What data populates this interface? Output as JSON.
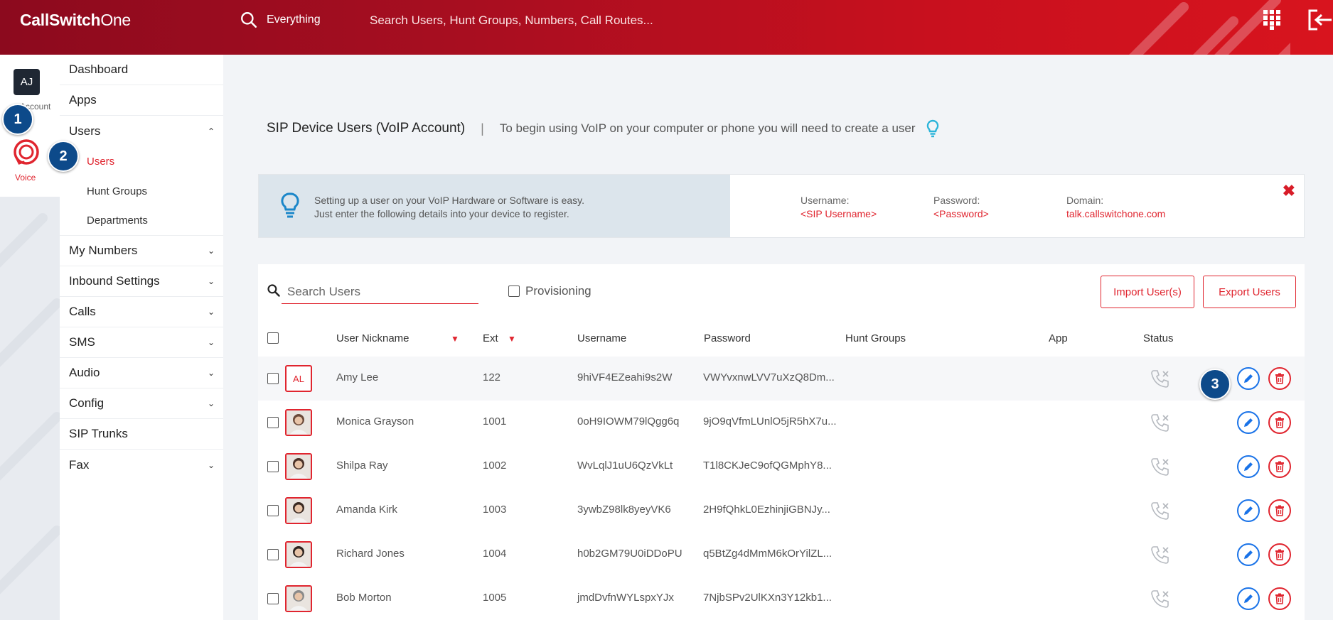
{
  "app": {
    "name_bold": "CallSwitch",
    "name_thin": "One"
  },
  "top_search": {
    "scope": "Everything",
    "placeholder": "Search Users, Hunt Groups, Numbers, Call Routes..."
  },
  "rail": {
    "avatar_initials": "AJ",
    "account_label": "Account",
    "voice_label": "Voice"
  },
  "callouts": [
    "1",
    "2",
    "3"
  ],
  "menu": {
    "items_top": [
      {
        "label": "Dashboard"
      },
      {
        "label": "Apps"
      },
      {
        "label": "Users",
        "chevron": "up"
      }
    ],
    "sub_items": [
      {
        "label": "Users",
        "active": true
      },
      {
        "label": "Hunt Groups"
      },
      {
        "label": "Departments"
      }
    ],
    "items_bottom": [
      {
        "label": "My Numbers",
        "chevron": "down"
      },
      {
        "label": "Inbound Settings",
        "chevron": "down"
      },
      {
        "label": "Calls",
        "chevron": "down"
      },
      {
        "label": "SMS",
        "chevron": "down"
      },
      {
        "label": "Audio",
        "chevron": "down"
      },
      {
        "label": "Config",
        "chevron": "down"
      },
      {
        "label": "SIP Trunks"
      },
      {
        "label": "Fax",
        "chevron": "down"
      }
    ]
  },
  "header": {
    "title": "SIP Device Users (VoIP Account)",
    "separator": "|",
    "hint": "To begin using VoIP on your computer or phone you will need to create a user"
  },
  "banner": {
    "line1": "Setting up a user on your VoIP Hardware or Software is easy.",
    "line2": "Just enter the following details into your device to register.",
    "username_label": "Username:",
    "username_value": "<SIP Username>",
    "password_label": "Password:",
    "password_value": "<Password>",
    "domain_label": "Domain:",
    "domain_value": "talk.callswitchone.com",
    "close": "✖"
  },
  "toolbar": {
    "search_placeholder": "Search Users",
    "provisioning_label": "Provisioning",
    "import_label": "Import User(s)",
    "export_label": "Export Users"
  },
  "columns": {
    "nickname": "User Nickname",
    "ext": "Ext",
    "username": "Username",
    "password": "Password",
    "hunt_groups": "Hunt Groups",
    "app": "App",
    "status": "Status"
  },
  "rows": [
    {
      "initials": "AL",
      "nickname": "Amy Lee",
      "ext": "122",
      "username": "9hiVF4EZeahi9s2W",
      "password": "VWYvxnwLVV7uXzQ8Dm...",
      "photo": null
    },
    {
      "initials": "",
      "nickname": "Monica Grayson",
      "ext": "1001",
      "username": "0oH9IOWM79lQgg6q",
      "password": "9jO9qVfmLUnlO5jR5hX7u...",
      "photo": "#6b4a3a"
    },
    {
      "initials": "",
      "nickname": "Shilpa Ray",
      "ext": "1002",
      "username": "WvLqlJ1uU6QzVkLt",
      "password": "T1l8CKJeC9ofQGMphY8...",
      "photo": "#4a3128"
    },
    {
      "initials": "",
      "nickname": "Amanda Kirk",
      "ext": "1003",
      "username": "3ywbZ98lk8yeyVK6",
      "password": "2H9fQhkL0EzhinjiGBNJy...",
      "photo": "#3b2a22"
    },
    {
      "initials": "",
      "nickname": "Richard Jones",
      "ext": "1004",
      "username": "h0b2GM79U0iDDoPU",
      "password": "q5BtZg4dMmM6kOrYilZL...",
      "photo": "#2e2420"
    },
    {
      "initials": "",
      "nickname": "Bob Morton",
      "ext": "1005",
      "username": "jmdDvfnWYLspxYJx",
      "password": "7NjbSPv2UlKXn3Y12kb1...",
      "photo": "#8a8a8a"
    }
  ],
  "colors": {
    "brand_red": "#e0252f",
    "edit_blue": "#1a73e8",
    "callout_blue": "#0d4a8a"
  }
}
